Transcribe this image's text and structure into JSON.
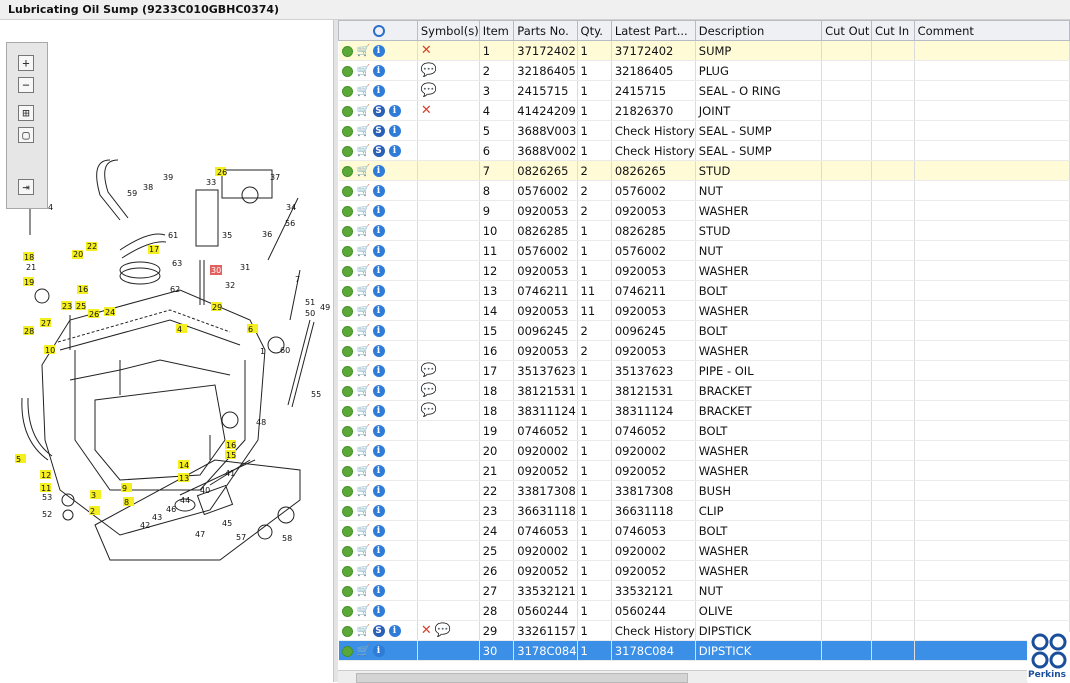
{
  "window": {
    "title": "Lubricating Oil Sump (9233C010GBHC0374)"
  },
  "toolbar": {
    "buttons": [
      {
        "name": "zoom-in-button",
        "glyph": "+"
      },
      {
        "name": "zoom-out-button",
        "glyph": "−"
      },
      {
        "name": "fit-all-button",
        "glyph": "⊞"
      },
      {
        "name": "fit-window-button",
        "glyph": "▢"
      },
      {
        "name": "export-button",
        "glyph": "⇥"
      }
    ]
  },
  "diagram": {
    "callouts": [
      "1",
      "2",
      "3",
      "4",
      "5",
      "6",
      "8",
      "9",
      "10",
      "11",
      "12",
      "13",
      "14",
      "15",
      "16",
      "17",
      "18",
      "19",
      "20",
      "21",
      "22",
      "23",
      "24",
      "25",
      "26",
      "27",
      "28",
      "29",
      "30",
      "31",
      "32",
      "33",
      "34",
      "35",
      "36",
      "37",
      "38",
      "39",
      "40",
      "41",
      "42",
      "43",
      "44",
      "45",
      "46",
      "47",
      "48",
      "49",
      "50",
      "51",
      "52",
      "55",
      "56",
      "57",
      "58",
      "59",
      "60",
      "61",
      "62",
      "63"
    ],
    "highlighted_callout": "30"
  },
  "grid": {
    "headers": {
      "search": "",
      "symbols": "Symbol(s)",
      "item": "Item",
      "parts_no": "Parts No.",
      "qty": "Qty.",
      "latest_part": "Latest Part...",
      "description": "Description",
      "cut_out": "Cut Out",
      "cut_in": "Cut In",
      "comment": "Comment"
    },
    "rows": [
      {
        "item": "1",
        "parts_no": "37172402",
        "qty": "1",
        "latest": "37172402",
        "desc": "SUMP",
        "s": false,
        "sym": [
          "x"
        ],
        "hl": true
      },
      {
        "item": "2",
        "parts_no": "32186405",
        "qty": "1",
        "latest": "32186405",
        "desc": "PLUG",
        "s": false,
        "sym": [
          "bubble"
        ],
        "hl": false
      },
      {
        "item": "3",
        "parts_no": "2415715",
        "qty": "1",
        "latest": "2415715",
        "desc": "SEAL - O RING",
        "s": false,
        "sym": [
          "bubble"
        ],
        "hl": false
      },
      {
        "item": "4",
        "parts_no": "41424209",
        "qty": "1",
        "latest": "21826370",
        "desc": "JOINT",
        "s": true,
        "sym": [
          "x"
        ],
        "hl": false
      },
      {
        "item": "5",
        "parts_no": "3688V003",
        "qty": "1",
        "latest": "Check History",
        "desc": "SEAL - SUMP",
        "s": true,
        "sym": [],
        "hl": false
      },
      {
        "item": "6",
        "parts_no": "3688V002",
        "qty": "1",
        "latest": "Check History",
        "desc": "SEAL - SUMP",
        "s": true,
        "sym": [],
        "hl": false
      },
      {
        "item": "7",
        "parts_no": "0826265",
        "qty": "2",
        "latest": "0826265",
        "desc": "STUD",
        "s": false,
        "sym": [],
        "hl": true
      },
      {
        "item": "8",
        "parts_no": "0576002",
        "qty": "2",
        "latest": "0576002",
        "desc": "NUT",
        "s": false,
        "sym": [],
        "hl": false
      },
      {
        "item": "9",
        "parts_no": "0920053",
        "qty": "2",
        "latest": "0920053",
        "desc": "WASHER",
        "s": false,
        "sym": [],
        "hl": false
      },
      {
        "item": "10",
        "parts_no": "0826285",
        "qty": "1",
        "latest": "0826285",
        "desc": "STUD",
        "s": false,
        "sym": [],
        "hl": false
      },
      {
        "item": "11",
        "parts_no": "0576002",
        "qty": "1",
        "latest": "0576002",
        "desc": "NUT",
        "s": false,
        "sym": [],
        "hl": false
      },
      {
        "item": "12",
        "parts_no": "0920053",
        "qty": "1",
        "latest": "0920053",
        "desc": "WASHER",
        "s": false,
        "sym": [],
        "hl": false
      },
      {
        "item": "13",
        "parts_no": "0746211",
        "qty": "11",
        "latest": "0746211",
        "desc": "BOLT",
        "s": false,
        "sym": [],
        "hl": false
      },
      {
        "item": "14",
        "parts_no": "0920053",
        "qty": "11",
        "latest": "0920053",
        "desc": "WASHER",
        "s": false,
        "sym": [],
        "hl": false
      },
      {
        "item": "15",
        "parts_no": "0096245",
        "qty": "2",
        "latest": "0096245",
        "desc": "BOLT",
        "s": false,
        "sym": [],
        "hl": false
      },
      {
        "item": "16",
        "parts_no": "0920053",
        "qty": "2",
        "latest": "0920053",
        "desc": "WASHER",
        "s": false,
        "sym": [],
        "hl": false
      },
      {
        "item": "17",
        "parts_no": "35137623",
        "qty": "1",
        "latest": "35137623",
        "desc": "PIPE - OIL",
        "s": false,
        "sym": [
          "bubble"
        ],
        "hl": false
      },
      {
        "item": "18",
        "parts_no": "38121531",
        "qty": "1",
        "latest": "38121531",
        "desc": "BRACKET",
        "s": false,
        "sym": [
          "bubble"
        ],
        "hl": false
      },
      {
        "item": "18",
        "parts_no": "38311124",
        "qty": "1",
        "latest": "38311124",
        "desc": "BRACKET",
        "s": false,
        "sym": [
          "bubble"
        ],
        "hl": false
      },
      {
        "item": "19",
        "parts_no": "0746052",
        "qty": "1",
        "latest": "0746052",
        "desc": "BOLT",
        "s": false,
        "sym": [],
        "hl": false
      },
      {
        "item": "20",
        "parts_no": "0920002",
        "qty": "1",
        "latest": "0920002",
        "desc": "WASHER",
        "s": false,
        "sym": [],
        "hl": false
      },
      {
        "item": "21",
        "parts_no": "0920052",
        "qty": "1",
        "latest": "0920052",
        "desc": "WASHER",
        "s": false,
        "sym": [],
        "hl": false
      },
      {
        "item": "22",
        "parts_no": "33817308",
        "qty": "1",
        "latest": "33817308",
        "desc": "BUSH",
        "s": false,
        "sym": [],
        "hl": false
      },
      {
        "item": "23",
        "parts_no": "36631118",
        "qty": "1",
        "latest": "36631118",
        "desc": "CLIP",
        "s": false,
        "sym": [],
        "hl": false
      },
      {
        "item": "24",
        "parts_no": "0746053",
        "qty": "1",
        "latest": "0746053",
        "desc": "BOLT",
        "s": false,
        "sym": [],
        "hl": false
      },
      {
        "item": "25",
        "parts_no": "0920002",
        "qty": "1",
        "latest": "0920002",
        "desc": "WASHER",
        "s": false,
        "sym": [],
        "hl": false
      },
      {
        "item": "26",
        "parts_no": "0920052",
        "qty": "1",
        "latest": "0920052",
        "desc": "WASHER",
        "s": false,
        "sym": [],
        "hl": false
      },
      {
        "item": "27",
        "parts_no": "33532121",
        "qty": "1",
        "latest": "33532121",
        "desc": "NUT",
        "s": false,
        "sym": [],
        "hl": false
      },
      {
        "item": "28",
        "parts_no": "0560244",
        "qty": "1",
        "latest": "0560244",
        "desc": "OLIVE",
        "s": false,
        "sym": [],
        "hl": false
      },
      {
        "item": "29",
        "parts_no": "33261157",
        "qty": "1",
        "latest": "Check History",
        "desc": "DIPSTICK",
        "s": true,
        "sym": [
          "x",
          "bubble"
        ],
        "hl": false
      },
      {
        "item": "30",
        "parts_no": "3178C084",
        "qty": "1",
        "latest": "3178C084",
        "desc": "DIPSTICK",
        "s": false,
        "sym": [],
        "hl": false,
        "selected": true
      }
    ]
  },
  "brand": {
    "logo_text": "Perkins"
  },
  "colors": {
    "highlight_row": "#fffbd6",
    "selected_row": "#3b8fe6",
    "callout_yellow": "#f5ef20",
    "callout_red": "#e06060"
  }
}
